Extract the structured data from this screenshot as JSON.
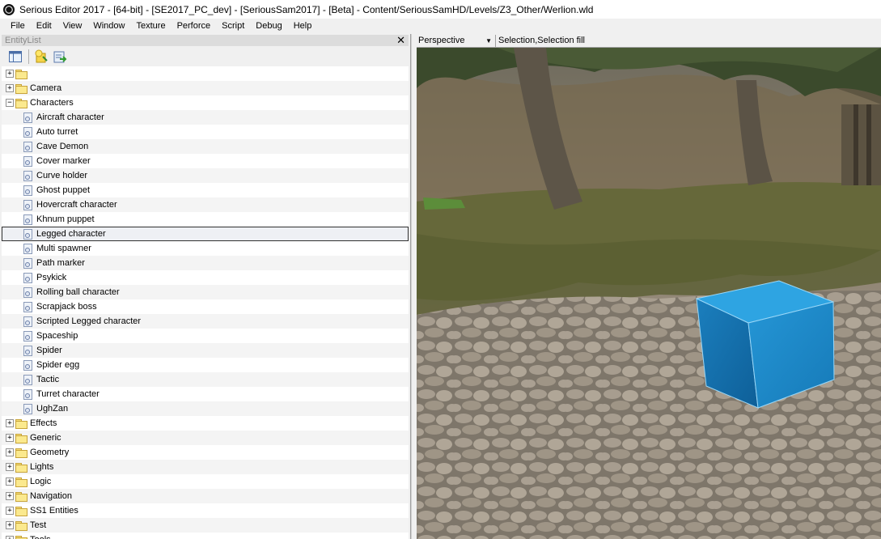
{
  "window": {
    "title": "Serious Editor 2017 - [64-bit] - [SE2017_PC_dev] - [SeriousSam2017] - [Beta] - Content/SeriousSamHD/Levels/Z3_Other/Werlion.wld"
  },
  "menu": [
    "File",
    "Edit",
    "View",
    "Window",
    "Texture",
    "Perforce",
    "Script",
    "Debug",
    "Help"
  ],
  "entity_list": {
    "title": "EntityList",
    "close_label": "✕",
    "toolbar_icons": [
      "panel-layout-icon",
      "add-entity-icon",
      "export-icon"
    ],
    "rows": [
      {
        "label": "",
        "type": "folder",
        "expander": "+"
      },
      {
        "label": "Camera",
        "type": "folder",
        "expander": "+"
      },
      {
        "label": "Characters",
        "type": "folder",
        "expander": "−"
      },
      {
        "label": "Aircraft character",
        "type": "item"
      },
      {
        "label": "Auto turret",
        "type": "item"
      },
      {
        "label": "Cave Demon",
        "type": "item"
      },
      {
        "label": "Cover marker",
        "type": "item"
      },
      {
        "label": "Curve holder",
        "type": "item"
      },
      {
        "label": "Ghost puppet",
        "type": "item"
      },
      {
        "label": "Hovercraft character",
        "type": "item"
      },
      {
        "label": "Khnum puppet",
        "type": "item"
      },
      {
        "label": "Legged character",
        "type": "item",
        "selected": true
      },
      {
        "label": "Multi spawner",
        "type": "item"
      },
      {
        "label": "Path marker",
        "type": "item"
      },
      {
        "label": "Psykick",
        "type": "item"
      },
      {
        "label": "Rolling ball character",
        "type": "item"
      },
      {
        "label": "Scrapjack boss",
        "type": "item"
      },
      {
        "label": "Scripted Legged character",
        "type": "item"
      },
      {
        "label": "Spaceship",
        "type": "item"
      },
      {
        "label": "Spider",
        "type": "item"
      },
      {
        "label": "Spider egg",
        "type": "item"
      },
      {
        "label": "Tactic",
        "type": "item"
      },
      {
        "label": "Turret character",
        "type": "item"
      },
      {
        "label": "UghZan",
        "type": "item"
      },
      {
        "label": "Effects",
        "type": "folder",
        "expander": "+"
      },
      {
        "label": "Generic",
        "type": "folder",
        "expander": "+"
      },
      {
        "label": "Geometry",
        "type": "folder",
        "expander": "+"
      },
      {
        "label": "Lights",
        "type": "folder",
        "expander": "+"
      },
      {
        "label": "Logic",
        "type": "folder",
        "expander": "+"
      },
      {
        "label": "Navigation",
        "type": "folder",
        "expander": "+"
      },
      {
        "label": "SS1 Entities",
        "type": "folder",
        "expander": "+"
      },
      {
        "label": "Test",
        "type": "folder",
        "expander": "+"
      },
      {
        "label": "Tools",
        "type": "folder",
        "expander": "+"
      }
    ]
  },
  "viewport": {
    "view_mode": "Perspective",
    "selection_mode": "Selection,Selection fill",
    "cube_color": "#1a86c4"
  }
}
